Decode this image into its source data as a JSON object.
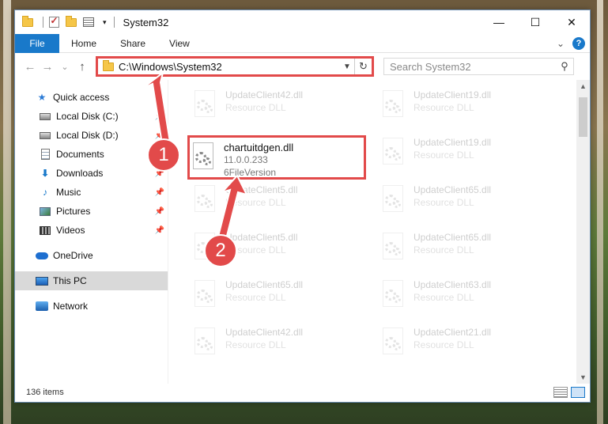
{
  "window": {
    "title": "System32",
    "controls": {
      "minimize": "—",
      "maximize": "☐",
      "close": "✕"
    }
  },
  "ribbon": {
    "tabs": [
      "File",
      "Home",
      "Share",
      "View"
    ],
    "help": "?",
    "expand": "⌄"
  },
  "nav": {
    "back": "←",
    "forward": "→",
    "recent": "⌄",
    "up": "↑",
    "address": "C:\\Windows\\System32",
    "address_dropdown": "▼",
    "refresh": "↻",
    "search_placeholder": "Search System32",
    "search_icon": "⚲"
  },
  "sidebar": {
    "quick_access": "Quick access",
    "items": [
      {
        "label": "Local Disk (C:)",
        "icon": "drive-icon"
      },
      {
        "label": "Local Disk (D:)",
        "icon": "drive-icon"
      },
      {
        "label": "Documents",
        "icon": "documents-icon"
      },
      {
        "label": "Downloads",
        "icon": "download-icon"
      },
      {
        "label": "Music",
        "icon": "music-icon"
      },
      {
        "label": "Pictures",
        "icon": "pictures-icon"
      },
      {
        "label": "Videos",
        "icon": "videos-icon"
      }
    ],
    "onedrive": "OneDrive",
    "this_pc": "This PC",
    "network": "Network"
  },
  "files": {
    "col1": [
      {
        "name": "UpdateClient42.dll",
        "sub": "Resource DLL"
      },
      {
        "name": "chartuitdgen.dll",
        "sub1": "11.0.0.233",
        "sub2": "6FileVersion"
      },
      {
        "name": "UpdateClient5.dll",
        "sub": "Resource DLL"
      },
      {
        "name": "UpdateClient5.dll",
        "sub": "Resource DLL"
      },
      {
        "name": "UpdateClient65.dll",
        "sub": "Resource DLL"
      },
      {
        "name": "UpdateClient42.dll",
        "sub": "Resource DLL"
      }
    ],
    "col2": [
      {
        "name": "UpdateClient19.dll",
        "sub": "Resource DLL"
      },
      {
        "name": "UpdateClient19.dll",
        "sub": "Resource DLL"
      },
      {
        "name": "UpdateClient65.dll",
        "sub": "Resource DLL"
      },
      {
        "name": "UpdateClient65.dll",
        "sub": "Resource DLL"
      },
      {
        "name": "UpdateClient63.dll",
        "sub": "Resource DLL"
      },
      {
        "name": "UpdateClient21.dll",
        "sub": "Resource DLL"
      }
    ]
  },
  "annotations": {
    "step1": "1",
    "step2": "2"
  },
  "status": {
    "count": "136 items"
  },
  "colors": {
    "accent": "#1979ca",
    "highlight": "#e24a4a"
  }
}
